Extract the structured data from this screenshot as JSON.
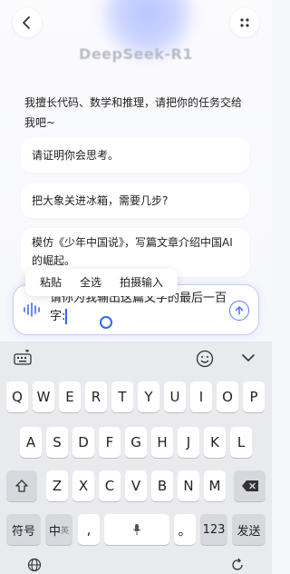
{
  "header": {
    "title": "DeepSeek-R1"
  },
  "intro": "我擅长代码、数学和推理，请把你的任务交给我吧~",
  "suggestions": [
    "请证明你会思考。",
    "把大象关进冰箱，需要几步?",
    "模仿《少年中国说》，写篇文章介绍中国AI的崛起。"
  ],
  "context_menu": [
    "粘贴",
    "全选",
    "拍摄输入"
  ],
  "input": {
    "value": "请你为我输出这篇文字的最后一百字:"
  },
  "keyboard": {
    "row1": [
      "Q",
      "W",
      "E",
      "R",
      "T",
      "Y",
      "U",
      "I",
      "O",
      "P"
    ],
    "row2": [
      "A",
      "S",
      "D",
      "F",
      "G",
      "H",
      "J",
      "K",
      "L"
    ],
    "row3": [
      "Z",
      "X",
      "C",
      "V",
      "B",
      "N",
      "M"
    ],
    "symbols_key": "符号",
    "lang_key": "中",
    "lang_sub": "英",
    "comma_key": ",",
    "period_key": "。",
    "numbers_key": "123",
    "send_key": "发送"
  },
  "colors": {
    "accent": "#3366ff",
    "send": "#5a78ff"
  }
}
